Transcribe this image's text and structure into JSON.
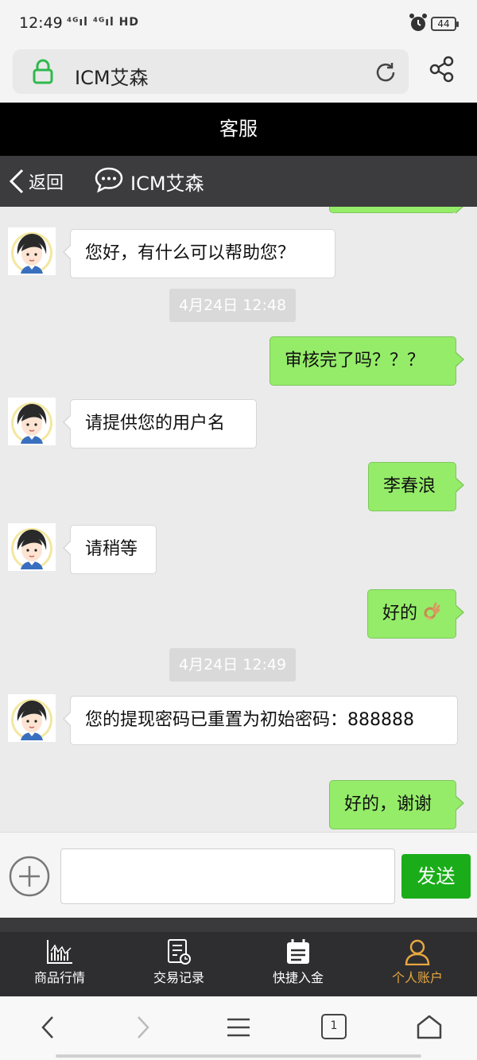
{
  "status": {
    "time": "12:49",
    "signal": "⁴ᴳıl ⁴ᴳıl HD",
    "battery": "44"
  },
  "browser": {
    "url": "ICM艾森"
  },
  "page": {
    "title": "客服"
  },
  "chat_header": {
    "back_label": "返回",
    "contact_name": "ICM艾森"
  },
  "messages": [
    {
      "side": "in",
      "text": "您好，有什么可以帮助您？"
    },
    {
      "timestamp": "4月24日 12:48"
    },
    {
      "side": "out",
      "text": "审核完了吗？？？"
    },
    {
      "side": "in",
      "text": "请提供您的用户名"
    },
    {
      "side": "out",
      "text": "李春浪"
    },
    {
      "side": "in",
      "text": "请稍等"
    },
    {
      "side": "out",
      "text": "好的",
      "emoji": "ok-hand-icon"
    },
    {
      "timestamp": "4月24日 12:49"
    },
    {
      "side": "in",
      "text": "您的提现密码已重置为初始密码：888888"
    },
    {
      "side": "out",
      "text": "好的，谢谢"
    }
  ],
  "input": {
    "send_label": "发送",
    "placeholder": ""
  },
  "tabs": [
    {
      "label": "商品行情",
      "icon": "chart-icon",
      "active": false
    },
    {
      "label": "交易记录",
      "icon": "record-icon",
      "active": false
    },
    {
      "label": "快捷入金",
      "icon": "calendar-icon",
      "active": false
    },
    {
      "label": "个人账户",
      "icon": "user-icon",
      "active": true
    }
  ],
  "navbar": {
    "tab_count": "1"
  },
  "colors": {
    "outgoing_bubble": "#95ec69",
    "send_button": "#1aad19",
    "active_tab": "#e6a640",
    "header": "#3c3c3e"
  }
}
